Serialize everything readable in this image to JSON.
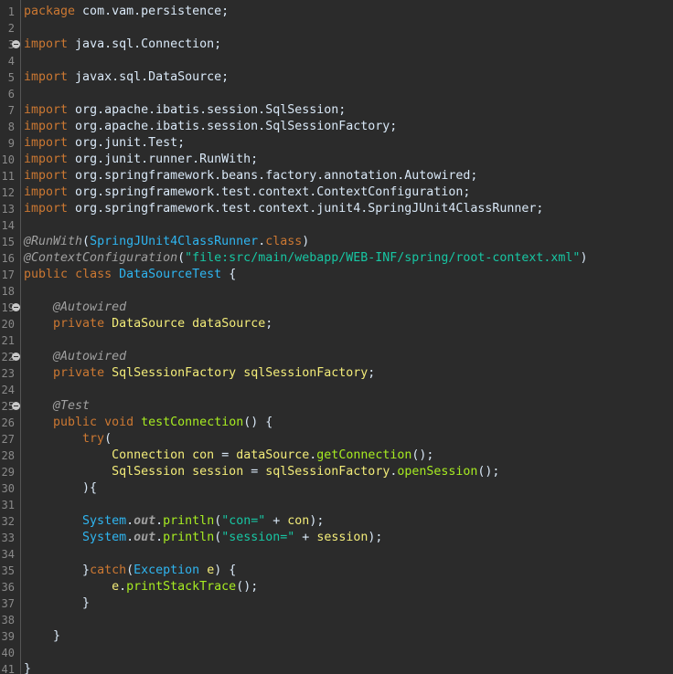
{
  "editor": {
    "lines": [
      {
        "n": "1",
        "fold": false,
        "tokens": [
          {
            "t": "package",
            "c": "keyword"
          },
          {
            "t": " com.vam.persistence;",
            "c": "plain"
          }
        ]
      },
      {
        "n": "2",
        "fold": false,
        "tokens": []
      },
      {
        "n": "3",
        "fold": true,
        "tokens": [
          {
            "t": "import",
            "c": "keyword"
          },
          {
            "t": " java.sql.Connection;",
            "c": "plain"
          }
        ]
      },
      {
        "n": "4",
        "fold": false,
        "tokens": []
      },
      {
        "n": "5",
        "fold": false,
        "tokens": [
          {
            "t": "import",
            "c": "keyword"
          },
          {
            "t": " javax.sql.DataSource;",
            "c": "plain"
          }
        ]
      },
      {
        "n": "6",
        "fold": false,
        "tokens": []
      },
      {
        "n": "7",
        "fold": false,
        "tokens": [
          {
            "t": "import",
            "c": "keyword"
          },
          {
            "t": " org.apache.ibatis.session.SqlSession;",
            "c": "plain"
          }
        ]
      },
      {
        "n": "8",
        "fold": false,
        "tokens": [
          {
            "t": "import",
            "c": "keyword"
          },
          {
            "t": " org.apache.ibatis.session.SqlSessionFactory;",
            "c": "plain"
          }
        ]
      },
      {
        "n": "9",
        "fold": false,
        "tokens": [
          {
            "t": "import",
            "c": "keyword"
          },
          {
            "t": " org.junit.Test;",
            "c": "plain"
          }
        ]
      },
      {
        "n": "10",
        "fold": false,
        "tokens": [
          {
            "t": "import",
            "c": "keyword"
          },
          {
            "t": " org.junit.runner.RunWith;",
            "c": "plain"
          }
        ]
      },
      {
        "n": "11",
        "fold": false,
        "tokens": [
          {
            "t": "import",
            "c": "keyword"
          },
          {
            "t": " org.springframework.beans.factory.annotation.Autowired;",
            "c": "plain"
          }
        ]
      },
      {
        "n": "12",
        "fold": false,
        "tokens": [
          {
            "t": "import",
            "c": "keyword"
          },
          {
            "t": " org.springframework.test.context.ContextConfiguration;",
            "c": "plain"
          }
        ]
      },
      {
        "n": "13",
        "fold": false,
        "tokens": [
          {
            "t": "import",
            "c": "keyword"
          },
          {
            "t": " org.springframework.test.context.junit4.SpringJUnit4ClassRunner;",
            "c": "plain"
          }
        ]
      },
      {
        "n": "14",
        "fold": false,
        "tokens": []
      },
      {
        "n": "15",
        "fold": false,
        "tokens": [
          {
            "t": "@RunWith",
            "c": "annotation"
          },
          {
            "t": "(",
            "c": "plain"
          },
          {
            "t": "SpringJUnit4ClassRunner",
            "c": "type"
          },
          {
            "t": ".",
            "c": "plain"
          },
          {
            "t": "class",
            "c": "keyword"
          },
          {
            "t": ")",
            "c": "plain"
          }
        ]
      },
      {
        "n": "16",
        "fold": false,
        "tokens": [
          {
            "t": "@ContextConfiguration",
            "c": "annotation"
          },
          {
            "t": "(",
            "c": "plain"
          },
          {
            "t": "\"file:src/main/webapp/WEB-INF/spring/root-context.xml\"",
            "c": "string"
          },
          {
            "t": ")",
            "c": "plain"
          }
        ]
      },
      {
        "n": "17",
        "fold": false,
        "tokens": [
          {
            "t": "public",
            "c": "keyword"
          },
          {
            "t": " ",
            "c": "plain"
          },
          {
            "t": "class",
            "c": "keyword"
          },
          {
            "t": " ",
            "c": "plain"
          },
          {
            "t": "DataSourceTest",
            "c": "type"
          },
          {
            "t": " {",
            "c": "plain"
          }
        ]
      },
      {
        "n": "18",
        "fold": false,
        "tokens": []
      },
      {
        "n": "19",
        "fold": true,
        "tokens": [
          {
            "t": "    ",
            "c": "plain"
          },
          {
            "t": "@Autowired",
            "c": "annotation"
          }
        ]
      },
      {
        "n": "20",
        "fold": false,
        "tokens": [
          {
            "t": "    ",
            "c": "plain"
          },
          {
            "t": "private",
            "c": "keyword"
          },
          {
            "t": " ",
            "c": "plain"
          },
          {
            "t": "DataSource",
            "c": "variable"
          },
          {
            "t": " ",
            "c": "plain"
          },
          {
            "t": "dataSource",
            "c": "variable"
          },
          {
            "t": ";",
            "c": "plain"
          }
        ]
      },
      {
        "n": "21",
        "fold": false,
        "tokens": []
      },
      {
        "n": "22",
        "fold": true,
        "tokens": [
          {
            "t": "    ",
            "c": "plain"
          },
          {
            "t": "@Autowired",
            "c": "annotation"
          }
        ]
      },
      {
        "n": "23",
        "fold": false,
        "tokens": [
          {
            "t": "    ",
            "c": "plain"
          },
          {
            "t": "private",
            "c": "keyword"
          },
          {
            "t": " ",
            "c": "plain"
          },
          {
            "t": "SqlSessionFactory",
            "c": "variable"
          },
          {
            "t": " ",
            "c": "plain"
          },
          {
            "t": "sqlSessionFactory",
            "c": "variable"
          },
          {
            "t": ";",
            "c": "plain"
          }
        ]
      },
      {
        "n": "24",
        "fold": false,
        "tokens": []
      },
      {
        "n": "25",
        "fold": true,
        "tokens": [
          {
            "t": "    ",
            "c": "plain"
          },
          {
            "t": "@Test",
            "c": "annotation"
          }
        ]
      },
      {
        "n": "26",
        "fold": false,
        "tokens": [
          {
            "t": "    ",
            "c": "plain"
          },
          {
            "t": "public",
            "c": "keyword"
          },
          {
            "t": " ",
            "c": "plain"
          },
          {
            "t": "void",
            "c": "keyword"
          },
          {
            "t": " ",
            "c": "plain"
          },
          {
            "t": "testConnection",
            "c": "method"
          },
          {
            "t": "() {",
            "c": "plain"
          }
        ]
      },
      {
        "n": "27",
        "fold": false,
        "tokens": [
          {
            "t": "        ",
            "c": "plain"
          },
          {
            "t": "try",
            "c": "keyword"
          },
          {
            "t": "(",
            "c": "plain"
          }
        ]
      },
      {
        "n": "28",
        "fold": false,
        "tokens": [
          {
            "t": "            ",
            "c": "plain"
          },
          {
            "t": "Connection",
            "c": "variable"
          },
          {
            "t": " ",
            "c": "plain"
          },
          {
            "t": "con",
            "c": "variable"
          },
          {
            "t": " = ",
            "c": "plain"
          },
          {
            "t": "dataSource",
            "c": "variable"
          },
          {
            "t": ".",
            "c": "plain"
          },
          {
            "t": "getConnection",
            "c": "method"
          },
          {
            "t": "();",
            "c": "plain"
          }
        ]
      },
      {
        "n": "29",
        "fold": false,
        "tokens": [
          {
            "t": "            ",
            "c": "plain"
          },
          {
            "t": "SqlSession",
            "c": "variable"
          },
          {
            "t": " ",
            "c": "plain"
          },
          {
            "t": "session",
            "c": "variable"
          },
          {
            "t": " = ",
            "c": "plain"
          },
          {
            "t": "sqlSessionFactory",
            "c": "variable"
          },
          {
            "t": ".",
            "c": "plain"
          },
          {
            "t": "openSession",
            "c": "method"
          },
          {
            "t": "();",
            "c": "plain"
          }
        ]
      },
      {
        "n": "30",
        "fold": false,
        "tokens": [
          {
            "t": "        ){",
            "c": "plain"
          }
        ]
      },
      {
        "n": "31",
        "fold": false,
        "tokens": []
      },
      {
        "n": "32",
        "fold": false,
        "tokens": [
          {
            "t": "        ",
            "c": "plain"
          },
          {
            "t": "System",
            "c": "type"
          },
          {
            "t": ".",
            "c": "plain"
          },
          {
            "t": "out",
            "c": "static"
          },
          {
            "t": ".",
            "c": "plain"
          },
          {
            "t": "println",
            "c": "method"
          },
          {
            "t": "(",
            "c": "plain"
          },
          {
            "t": "\"con=\"",
            "c": "string"
          },
          {
            "t": " + ",
            "c": "plain"
          },
          {
            "t": "con",
            "c": "variable"
          },
          {
            "t": ");",
            "c": "plain"
          }
        ]
      },
      {
        "n": "33",
        "fold": false,
        "tokens": [
          {
            "t": "        ",
            "c": "plain"
          },
          {
            "t": "System",
            "c": "type"
          },
          {
            "t": ".",
            "c": "plain"
          },
          {
            "t": "out",
            "c": "static"
          },
          {
            "t": ".",
            "c": "plain"
          },
          {
            "t": "println",
            "c": "method"
          },
          {
            "t": "(",
            "c": "plain"
          },
          {
            "t": "\"session=\"",
            "c": "string"
          },
          {
            "t": " + ",
            "c": "plain"
          },
          {
            "t": "session",
            "c": "variable"
          },
          {
            "t": ");",
            "c": "plain"
          }
        ]
      },
      {
        "n": "34",
        "fold": false,
        "tokens": []
      },
      {
        "n": "35",
        "fold": false,
        "tokens": [
          {
            "t": "        }",
            "c": "plain"
          },
          {
            "t": "catch",
            "c": "keyword"
          },
          {
            "t": "(",
            "c": "plain"
          },
          {
            "t": "Exception",
            "c": "type"
          },
          {
            "t": " ",
            "c": "plain"
          },
          {
            "t": "e",
            "c": "variable"
          },
          {
            "t": ") {",
            "c": "plain"
          }
        ]
      },
      {
        "n": "36",
        "fold": false,
        "tokens": [
          {
            "t": "            ",
            "c": "plain"
          },
          {
            "t": "e",
            "c": "variable"
          },
          {
            "t": ".",
            "c": "plain"
          },
          {
            "t": "printStackTrace",
            "c": "method"
          },
          {
            "t": "();",
            "c": "plain"
          }
        ]
      },
      {
        "n": "37",
        "fold": false,
        "tokens": [
          {
            "t": "        }",
            "c": "plain"
          }
        ]
      },
      {
        "n": "38",
        "fold": false,
        "tokens": []
      },
      {
        "n": "39",
        "fold": false,
        "tokens": [
          {
            "t": "    }",
            "c": "plain"
          }
        ]
      },
      {
        "n": "40",
        "fold": false,
        "tokens": []
      },
      {
        "n": "41",
        "fold": false,
        "tokens": [
          {
            "t": "}",
            "c": "plain"
          }
        ]
      }
    ]
  }
}
